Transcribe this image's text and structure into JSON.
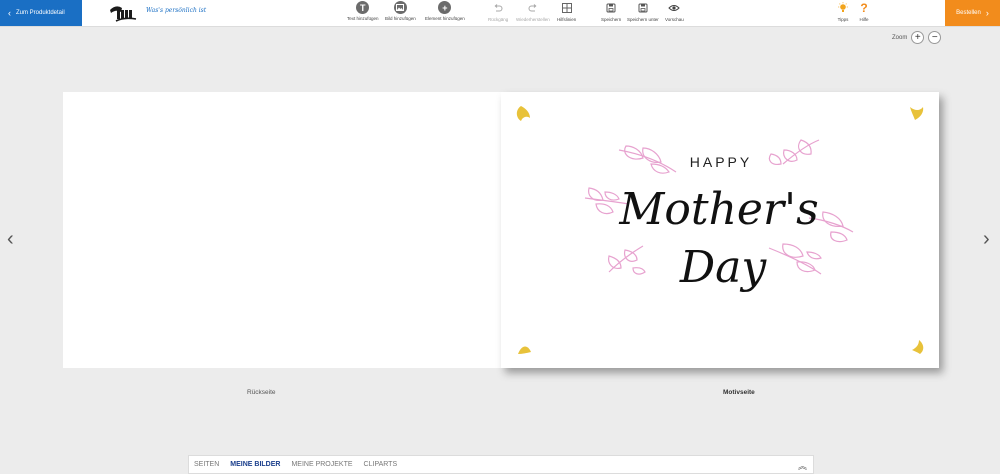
{
  "header": {
    "back_label": "Zum Produktdetail",
    "slogan": "Was's persönlich ist",
    "order_label": "Bestellen"
  },
  "toolbar": {
    "add_text": "Text hinzufügen",
    "add_image": "Bild hinzufügen",
    "add_element": "Element hinzufügen",
    "undo": "Rückgäng",
    "redo": "Wiederherstellen",
    "guides": "Hilfslinien",
    "save": "Speichern",
    "save_as": "Speichern unter",
    "preview": "Vorschau",
    "tips": "Tipps",
    "help": "Hilfe"
  },
  "zoom": {
    "label": "Zoom"
  },
  "canvas": {
    "back_label": "Rückseite",
    "front_label": "Motivseite",
    "motif": {
      "line1": "HAPPY",
      "line2": "Mother's",
      "line3": "Day"
    }
  },
  "bottom_tabs": [
    "SEITEN",
    "MEINE BILDER",
    "MEINE PROJEKTE",
    "CLIPARTS"
  ],
  "colors": {
    "primary_blue": "#1a6fc4",
    "order_orange": "#f28c1c",
    "leaf_pink": "#e7a2cf",
    "heart_gold": "#e8c23a"
  }
}
